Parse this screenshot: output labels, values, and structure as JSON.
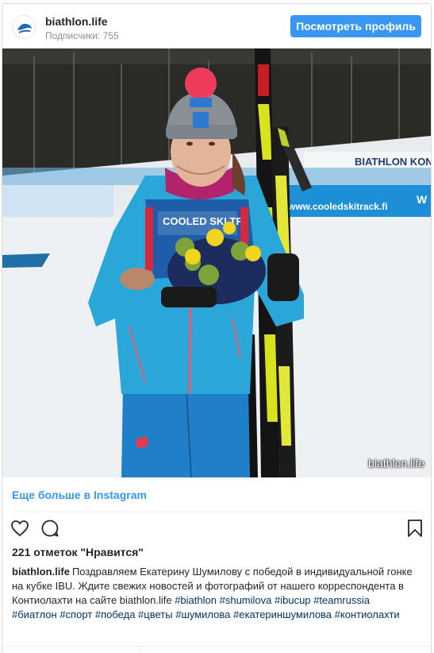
{
  "header": {
    "username": "biathlon.life",
    "followers": "Подписчики: 755",
    "view_profile_label": "Посмотреть профиль"
  },
  "photo": {
    "watermark": "biathlon.life",
    "banner_text_1": "BIATHLON KONT",
    "banner_text_2": "www.cooledskitrack.fi",
    "bib_text": "COOLED SKI TR",
    "fence_text": "W"
  },
  "more_link": "Еще больше в Instagram",
  "actions": {
    "like_icon": "heart-icon",
    "comment_icon": "comment-icon",
    "save_icon": "bookmark-icon"
  },
  "likes_text": "221 отметок \"Нравится\"",
  "caption": {
    "user": "biathlon.life",
    "text": "Поздравляем Екатерину Шумилову с победой в индивидуальной гонке на кубке IBU. Ждите свежих новостей и фотографий от нашего корреспондента в Контиолахти на сайте biathlon.life",
    "tags": [
      "#biathlon",
      "#shumilova",
      "#ibucup",
      "#teamrussia",
      "#биатлон",
      "#спорт",
      "#победа",
      "#цветы",
      "#шумилова",
      "#екатериншумилова",
      "#контиолахти"
    ]
  },
  "colors": {
    "accent": "#3897f0",
    "jacket": "#2aa6d8",
    "pants": "#1f7fc8",
    "hat_pom": "#ef3b5b"
  }
}
